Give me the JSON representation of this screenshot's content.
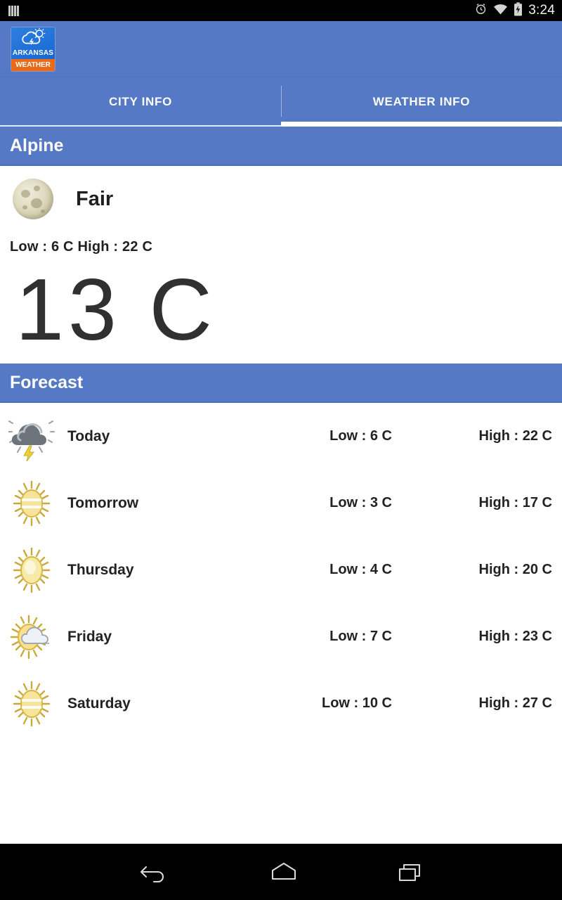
{
  "status_bar": {
    "signal_icon": "signal-bars-icon",
    "alarm_icon": "alarm-clock-icon",
    "wifi_icon": "wifi-icon",
    "battery_icon": "battery-charging-icon",
    "time": "3:24"
  },
  "app_bar": {
    "logo_icon": "arkansas-weather-logo",
    "logo_top_text": "ARKANSAS",
    "logo_bottom_text": "WEATHER",
    "background_color": "#5579c4"
  },
  "tabs": [
    {
      "label": "CITY INFO",
      "active": false
    },
    {
      "label": "WEATHER INFO",
      "active": true
    }
  ],
  "city_header": {
    "title": "Alpine"
  },
  "current": {
    "icon": "full-moon-icon",
    "condition": "Fair",
    "low_high": "Low : 6 C   High : 22 C",
    "temperature": "13 C"
  },
  "forecast_header": {
    "title": "Forecast"
  },
  "forecast": [
    {
      "icon": "thunderstorm-icon",
      "day": "Today",
      "low": "Low : 6 C",
      "high": "High : 22 C"
    },
    {
      "icon": "sun-haze-icon",
      "day": "Tomorrow",
      "low": "Low : 3 C",
      "high": "High : 17 C"
    },
    {
      "icon": "sun-icon",
      "day": "Thursday",
      "low": "Low : 4 C",
      "high": "High : 20 C"
    },
    {
      "icon": "sun-behind-cloud-icon",
      "day": "Friday",
      "low": "Low : 7 C",
      "high": "High : 23 C"
    },
    {
      "icon": "sun-haze-icon",
      "day": "Saturday",
      "low": "Low : 10 C",
      "high": "High : 27 C"
    }
  ],
  "nav_bar": {
    "back_icon": "back-arrow-icon",
    "home_icon": "home-icon",
    "recents_icon": "recent-apps-icon"
  },
  "colors": {
    "accent_blue": "#5579c4",
    "logo_orange": "#ea6a16",
    "text_dark": "#222222"
  }
}
